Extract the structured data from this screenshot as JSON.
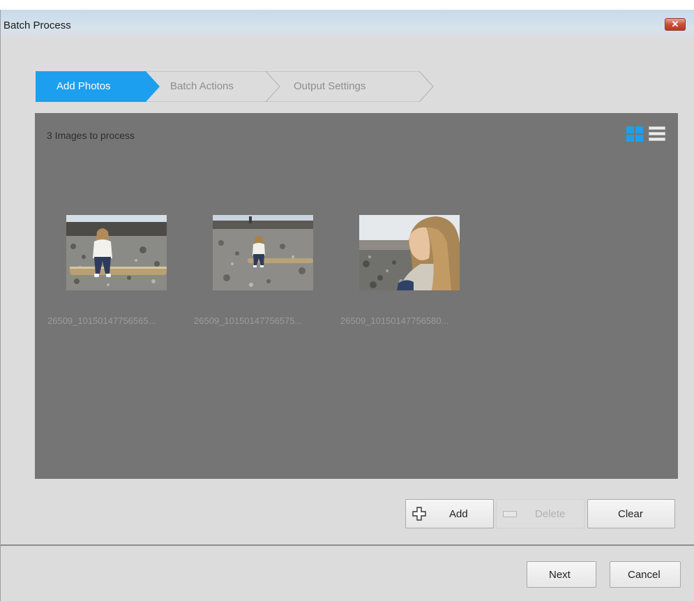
{
  "window": {
    "title": "Batch Process",
    "close_glyph": "✕"
  },
  "steps": [
    {
      "label": "Add Photos",
      "state": "active"
    },
    {
      "label": "Batch Actions",
      "state": "inactive"
    },
    {
      "label": "Output Settings",
      "state": "inactive"
    }
  ],
  "photos": {
    "count_label": "3 Images to process",
    "view_modes": [
      "grid-view-icon",
      "list-view-icon"
    ],
    "active_view": "grid-view-icon",
    "items": [
      {
        "caption": "26509_10150147756565..."
      },
      {
        "caption": "26509_10150147756575..."
      },
      {
        "caption": "26509_10150147756580..."
      }
    ]
  },
  "actions": {
    "add_label": "Add",
    "delete_label": "Delete",
    "clear_label": "Clear"
  },
  "footer": {
    "next_label": "Next",
    "cancel_label": "Cancel"
  },
  "colors": {
    "accent": "#1d9ff0",
    "panel": "#757575",
    "window": "#dcdcdc"
  }
}
